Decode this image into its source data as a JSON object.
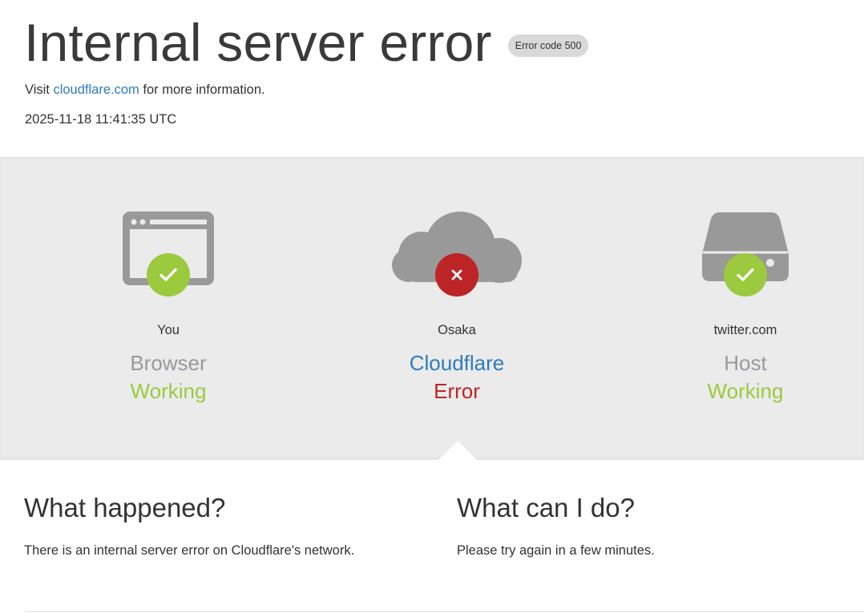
{
  "header": {
    "title": "Internal server error",
    "error_badge": "Error code 500",
    "visit_prefix": "Visit",
    "visit_link": "cloudflare.com",
    "visit_suffix": "for more information.",
    "timestamp": "2025-11-18 11:41:35 UTC"
  },
  "status_nodes": [
    {
      "location": "You",
      "role": "Browser",
      "state": "Working",
      "status": "ok",
      "icon": "browser-icon"
    },
    {
      "location": "Osaka",
      "role": "Cloudflare",
      "state": "Error",
      "status": "error",
      "icon": "cloud-icon"
    },
    {
      "location": "twitter.com",
      "role": "Host",
      "state": "Working",
      "status": "ok",
      "icon": "server-icon"
    }
  ],
  "info": {
    "what_happened_title": "What happened?",
    "what_happened_text": "There is an internal server error on Cloudflare's network.",
    "what_can_i_do_title": "What can I do?",
    "what_can_i_do_text": "Please try again in a few minutes."
  },
  "colors": {
    "working": "#9bca3e",
    "error": "#bd2426",
    "link": "#2f7bbf",
    "icon_gray": "#999999",
    "band_bg": "#ebebeb"
  }
}
